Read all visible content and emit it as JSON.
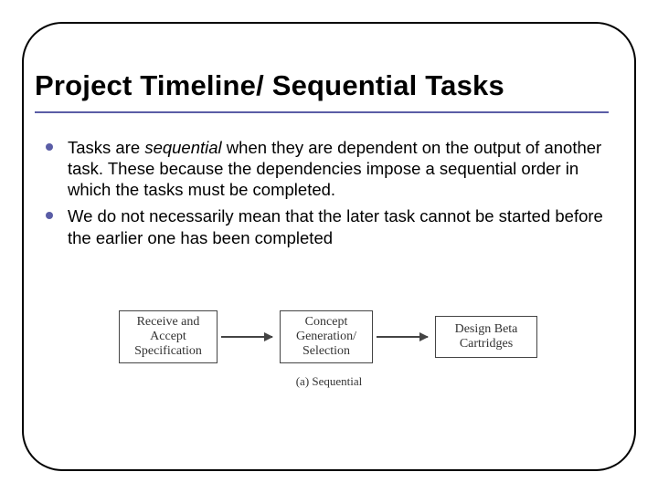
{
  "title": "Project Timeline/ Sequential Tasks",
  "bullets": [
    {
      "pre": "Tasks are ",
      "em": "sequential",
      "post": " when they are dependent on the output of another task. These because the dependencies impose a sequential order in which the tasks must be completed."
    },
    {
      "pre": "We do not necessarily mean that the later task cannot be started before the earlier one has been completed",
      "em": "",
      "post": ""
    }
  ],
  "diagram": {
    "box1": "Receive and\nAccept\nSpecification",
    "box2": "Concept\nGeneration/\nSelection",
    "box3": "Design Beta\nCartridges",
    "caption": "(a) Sequential"
  }
}
